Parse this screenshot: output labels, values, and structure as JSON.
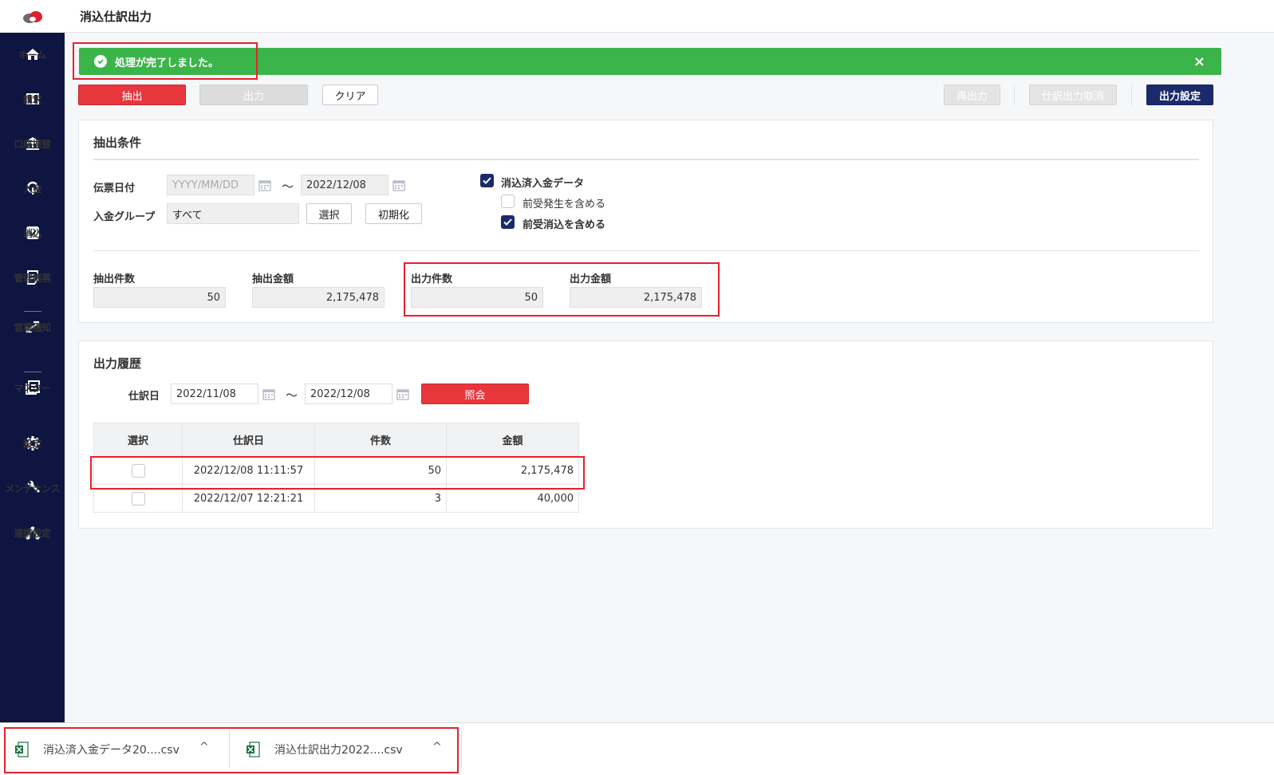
{
  "app": {
    "title": "消込仕訳出力"
  },
  "sidebar": {
    "items": [
      {
        "label": "ホーム",
        "icon": "home-icon"
      },
      {
        "label": "請求",
        "icon": "book-icon"
      },
      {
        "label": "口座振替",
        "icon": "bank-icon"
      },
      {
        "label": "入金",
        "icon": "deposit-icon"
      },
      {
        "label": "消込",
        "icon": "check-square-icon"
      },
      {
        "label": "管理帳票",
        "icon": "report-icon"
      },
      {
        "label": "営業通知",
        "icon": "arrows-icon"
      },
      {
        "label": "マスター",
        "icon": "list-icon"
      },
      {
        "label": "設定",
        "icon": "gear-icon"
      },
      {
        "label": "メンテナンス",
        "icon": "wrench-icon"
      },
      {
        "label": "連携設定",
        "icon": "network-icon"
      }
    ]
  },
  "alert": {
    "message": "処理が完了しました。",
    "close": "×",
    "color": "#3bb54a"
  },
  "toolbar": {
    "extract": "抽出",
    "output": "出力",
    "clear": "クリア",
    "reoutput": "再出力",
    "cancel_output": "仕訳出力取消",
    "output_settings": "出力設定"
  },
  "conditions": {
    "title": "抽出条件",
    "date_label": "伝票日付",
    "date_from_placeholder": "YYYY/MM/DD",
    "date_to": "2022/12/08",
    "tilde": "～",
    "group_label": "入金グループ",
    "group_value": "すべて",
    "select_button": "選択",
    "init_button": "初期化",
    "checkbox_main": "消込済入金データ",
    "checkbox_sub1": "前受発生を含める",
    "checkbox_sub2": "前受消込を含める"
  },
  "summary": {
    "extract_count_label": "抽出件数",
    "extract_count": "50",
    "extract_amount_label": "抽出金額",
    "extract_amount": "2,175,478",
    "output_count_label": "出力件数",
    "output_count": "50",
    "output_amount_label": "出力金額",
    "output_amount": "2,175,478"
  },
  "history": {
    "title": "出力履歴",
    "date_label": "仕訳日",
    "from": "2022/11/08",
    "to": "2022/12/08",
    "tilde": "～",
    "search_button": "照会",
    "columns": [
      "選択",
      "仕訳日",
      "件数",
      "金額"
    ],
    "rows": [
      {
        "date": "2022/12/08 11:11:57",
        "count": "50",
        "amount": "2,175,478"
      },
      {
        "date": "2022/12/07 12:21:21",
        "count": "3",
        "amount": "40,000"
      }
    ]
  },
  "downloads": [
    {
      "name": "消込済入金データ20....csv",
      "caret": "^"
    },
    {
      "name": "消込仕訳出力2022....csv",
      "caret": "^"
    }
  ]
}
